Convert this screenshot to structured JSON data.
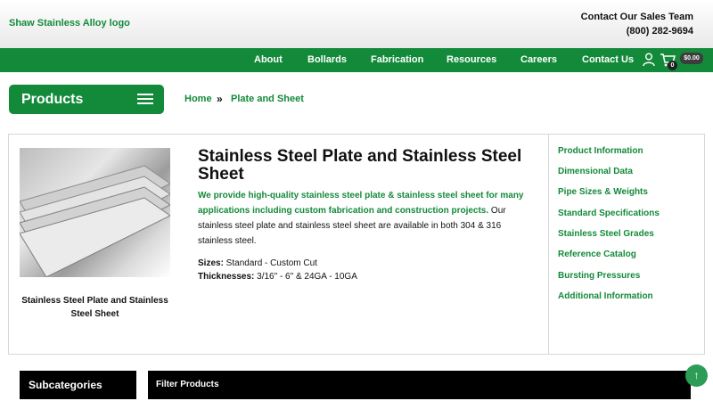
{
  "header": {
    "logo_alt": "Shaw Stainless Alloy logo",
    "contact_title": "Contact Our Sales Team",
    "phone": "(800) 282-9694"
  },
  "nav": {
    "items": [
      "About",
      "Bollards",
      "Fabrication",
      "Resources",
      "Careers",
      "Contact Us"
    ],
    "cart_count": "0",
    "cart_total": "$0.00",
    "icons": [
      "user-icon",
      "cart-icon"
    ]
  },
  "products_menu": {
    "label": "Products"
  },
  "breadcrumb": {
    "home": "Home",
    "separator": "»",
    "current": "Plate and Sheet"
  },
  "product": {
    "image_caption": "Stainless Steel Plate and Stainless Steel Sheet",
    "title": "Stainless Steel Plate and Stainless Steel Sheet",
    "description_highlight": "We provide high-quality stainless steel plate & stainless steel sheet for many applications including custom fabrication and construction projects.",
    "description_rest": " Our stainless steel plate and stainless steel sheet are available in both 304 & 316 stainless steel.",
    "sizes_label": "Sizes:",
    "sizes_value": " Standard - Custom Cut",
    "thickness_label": "Thicknesses:",
    "thickness_value": " 3/16\" - 6\" & 24GA - 10GA"
  },
  "side_links": [
    "Product Information",
    "Dimensional Data",
    "Pipe Sizes & Weights",
    "Standard Specifications",
    "Stainless Steel Grades",
    "Reference Catalog",
    "Bursting Pressures",
    "Additional Information"
  ],
  "bottom": {
    "subcategories": "Subcategories",
    "filter": "Filter Products",
    "to_top_icon": "arrow-up-icon"
  },
  "colors": {
    "brand_green": "#138a3a",
    "black": "#000000"
  }
}
